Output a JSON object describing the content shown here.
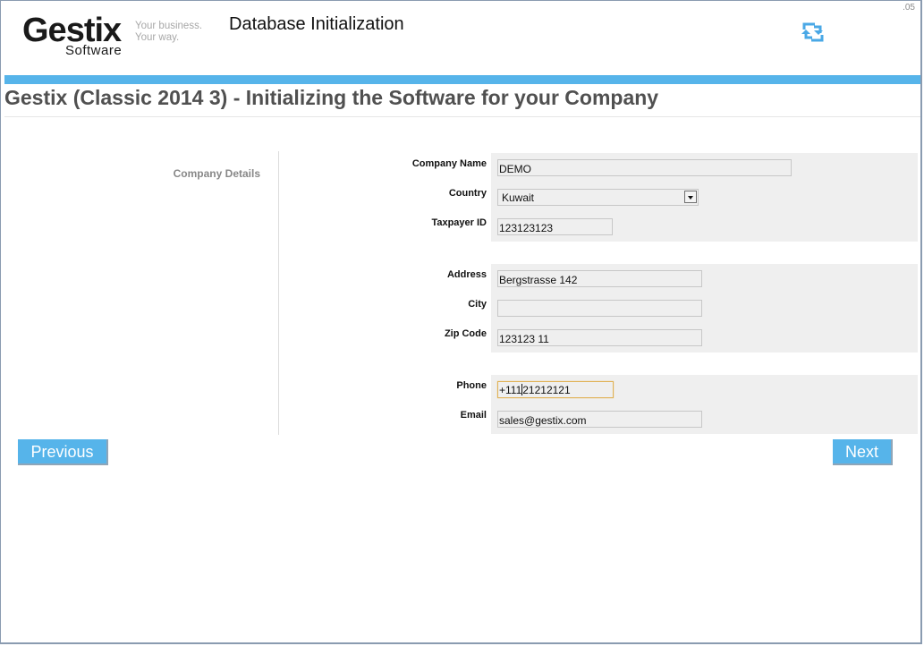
{
  "window": {
    "version_label": ".05"
  },
  "header": {
    "logo_name": "Gestix",
    "logo_sub": "Software",
    "tagline_line1": "Your business.",
    "tagline_line2": "Your way.",
    "app_title": "Database Initialization",
    "sync_icon": "sync-icon"
  },
  "page": {
    "title": "Gestix (Classic 2014 3) - Initializing the Software for your Company",
    "section_label": "Company Details"
  },
  "form": {
    "company_name": {
      "label": "Company Name",
      "value": "DEMO"
    },
    "country": {
      "label": "Country",
      "value": "Kuwait"
    },
    "taxpayer_id": {
      "label": "Taxpayer ID",
      "value": "123123123"
    },
    "address": {
      "label": "Address",
      "value": "Bergstrasse 142"
    },
    "city": {
      "label": "City",
      "value": ""
    },
    "zip_code": {
      "label": "Zip Code",
      "value": "123123 11"
    },
    "phone": {
      "label": "Phone",
      "value": "+111 21212121",
      "value_before_caret": "+111",
      "value_after_caret": "21212121"
    },
    "email": {
      "label": "Email",
      "value": "sales@gestix.com"
    }
  },
  "buttons": {
    "previous": "Previous",
    "next": "Next"
  },
  "colors": {
    "accent": "#56b4ea",
    "panel_bg": "#efefef",
    "focus_border": "#e0b256"
  }
}
